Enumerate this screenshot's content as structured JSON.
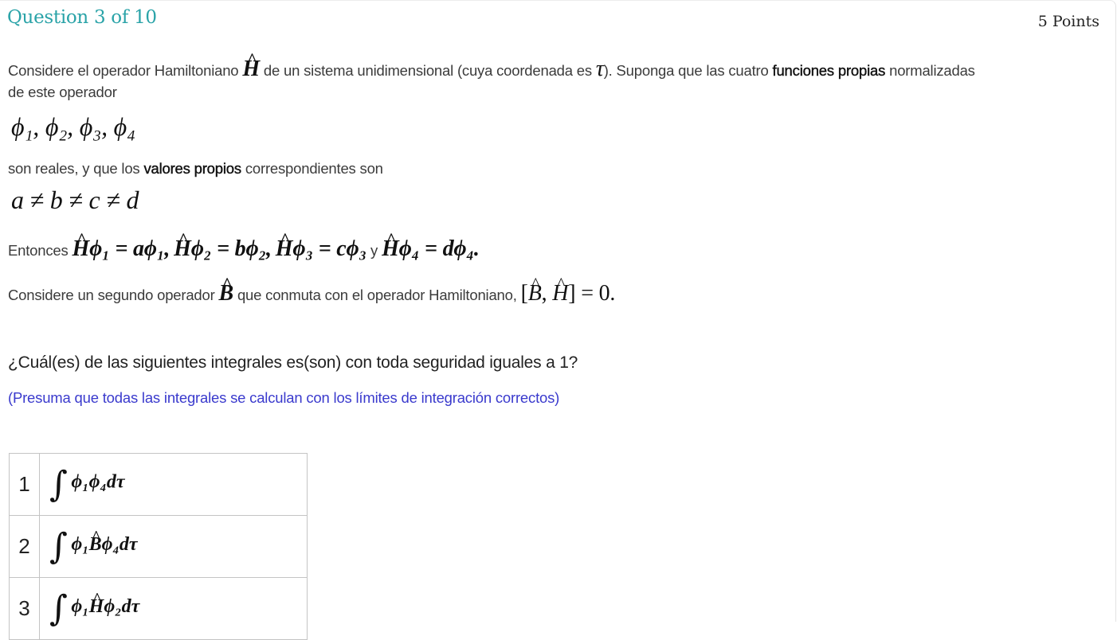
{
  "header": {
    "question_label": "Question 3 of 10",
    "points_label": "5 Points",
    "accent_color": "#2aa3a8"
  },
  "body": {
    "p1_a": "Considere el operador Hamiltoniano",
    "p1_H": "H",
    "p1_b": "de un sistema unidimensional (cuya coordenada es",
    "p1_tau": "τ",
    "p1_c": ").  Suponga que las cuatro",
    "p1_bold": "funciones propias",
    "p1_d": "normalizadas",
    "p1_e": "de este operador",
    "eigenfunctions": "ϕ₁,  ϕ₂,  ϕ₃,  ϕ₄",
    "p2_a": "son reales, y que los",
    "p2_bold": "valores propios",
    "p2_b": "correspondientes son",
    "eigenvalues": "a ≠ b ≠ c ≠ d",
    "p3_label": "Entonces",
    "p3_eq1": "ϕ₁ = aϕ₁,",
    "p3_eq2": "ϕ₂ = bϕ₂,",
    "p3_eq3": "ϕ₃ = cϕ₃",
    "p3_and": "y",
    "p3_eq4": "ϕ₄ = dϕ₄.",
    "p4_a": "Considere un segundo operador",
    "p4_B": "B",
    "p4_b": "que conmuta con el operador Hamiltoniano,",
    "p4_comm_open": "[",
    "p4_comm_B": "B",
    "p4_comm_sep": ", ",
    "p4_comm_H": "H",
    "p4_comm_close": "] = 0.",
    "H": "H"
  },
  "question": {
    "text": "¿Cuál(es) de las siguientes integrales es(son) con toda seguridad iguales a 1?",
    "hint": "(Presuma que todas las integrales se calculan con los límites de integración correctos)",
    "hint_color": "#3a3acd"
  },
  "options": [
    {
      "num": "1",
      "integral": "∫",
      "pre": "ϕ₁ϕ₄dτ",
      "op": "",
      "post": ""
    },
    {
      "num": "2",
      "integral": "∫",
      "pre": "ϕ₁",
      "op": "B",
      "post": "ϕ₄dτ"
    },
    {
      "num": "3",
      "integral": "∫",
      "pre": "ϕ₁",
      "op": "H",
      "post": "ϕ₂dτ"
    }
  ]
}
